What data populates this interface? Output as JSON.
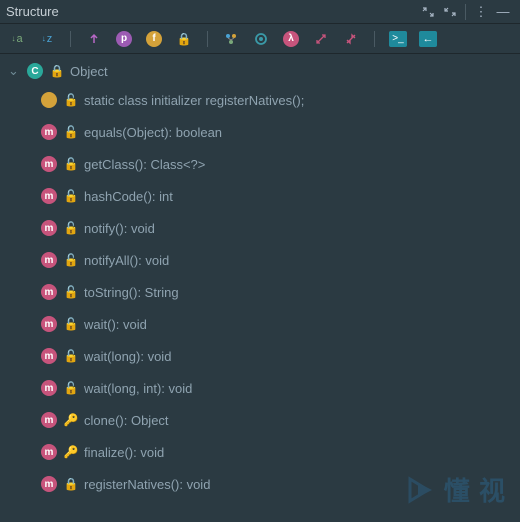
{
  "title": "Structure",
  "toolbar_icons": {
    "sort_alpha": "↓a",
    "sort_visibility": "↓z",
    "show_fields": "↑",
    "p_icon": "p",
    "f_icon": "f",
    "lock_icon": "🔒",
    "inherited": "⬡",
    "interfaces": "◯",
    "lambda": "λ",
    "expand": "⤢",
    "collapse": "⤡",
    "terminal": ">_",
    "back": "←"
  },
  "titlebar_icons": {
    "expand_all": "⤢",
    "collapse_all": "⤡",
    "more": "⋮",
    "hide": "—"
  },
  "class_row": {
    "name": "Object"
  },
  "members": [
    {
      "kind": "static",
      "vis": "public",
      "sig": "static class initializer  registerNatives();"
    },
    {
      "kind": "method",
      "vis": "public",
      "sig": "equals(Object): boolean"
    },
    {
      "kind": "method",
      "vis": "public",
      "sig": "getClass(): Class<?>"
    },
    {
      "kind": "method",
      "vis": "public",
      "sig": "hashCode(): int"
    },
    {
      "kind": "method",
      "vis": "public",
      "sig": "notify(): void"
    },
    {
      "kind": "method",
      "vis": "public",
      "sig": "notifyAll(): void"
    },
    {
      "kind": "method",
      "vis": "public",
      "sig": "toString(): String"
    },
    {
      "kind": "method",
      "vis": "public",
      "sig": "wait(): void"
    },
    {
      "kind": "method",
      "vis": "public",
      "sig": "wait(long): void"
    },
    {
      "kind": "method",
      "vis": "public",
      "sig": "wait(long, int): void"
    },
    {
      "kind": "method",
      "vis": "protected",
      "sig": "clone(): Object"
    },
    {
      "kind": "method",
      "vis": "protected",
      "sig": "finalize(): void"
    },
    {
      "kind": "method",
      "vis": "private",
      "sig": "registerNatives(): void"
    }
  ],
  "watermark": "懂 视"
}
